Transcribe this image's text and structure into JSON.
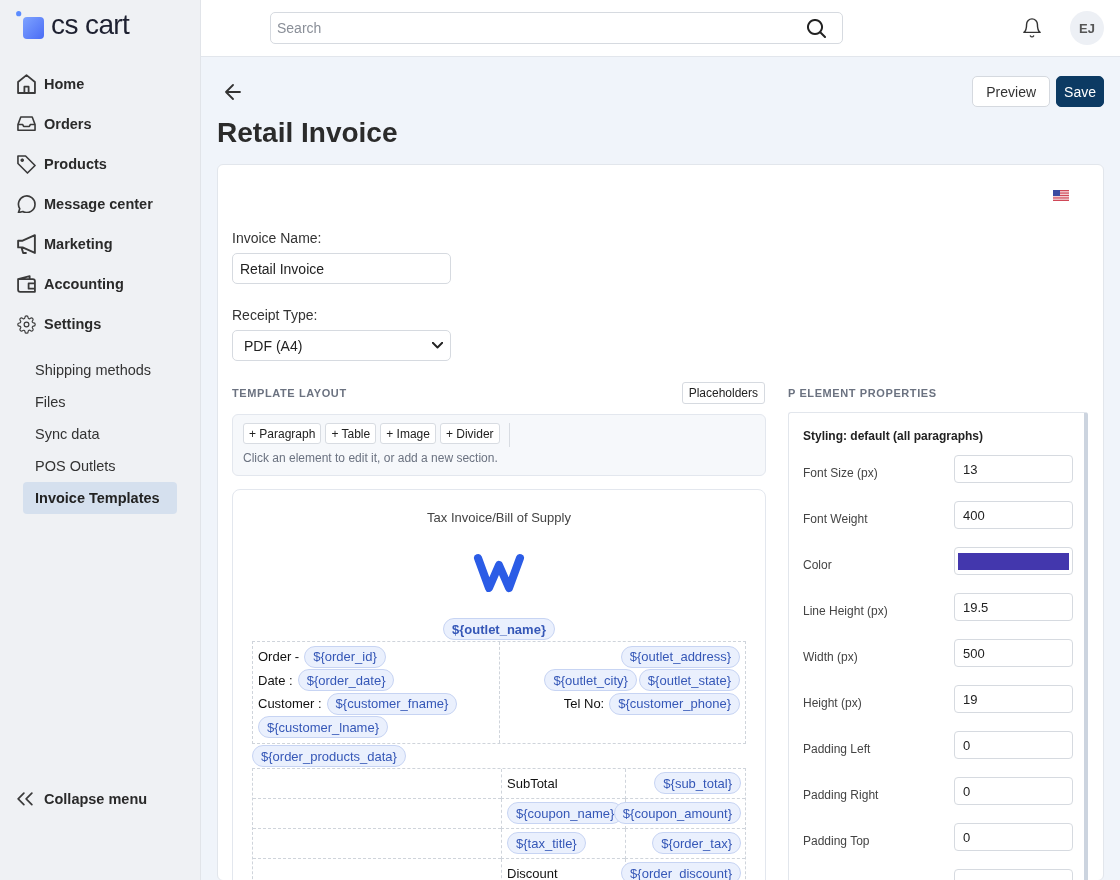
{
  "sidebar": {
    "logo_text": "cs cart",
    "items": [
      {
        "label": "Home",
        "selected": false
      },
      {
        "label": "Orders",
        "selected": false
      },
      {
        "label": "Products",
        "selected": false
      },
      {
        "label": "Message center",
        "selected": false
      },
      {
        "label": "Marketing",
        "selected": false
      },
      {
        "label": "Accounting",
        "selected": false
      },
      {
        "label": "Settings",
        "selected": false,
        "children": [
          {
            "label": "Shipping methods",
            "selected": false
          },
          {
            "label": "Files",
            "selected": false
          },
          {
            "label": "Sync data",
            "selected": false
          },
          {
            "label": "POS Outlets",
            "selected": false
          },
          {
            "label": "Invoice Templates",
            "selected": true
          }
        ]
      }
    ],
    "collapse_label": "Collapse menu"
  },
  "topbar": {
    "search": {
      "placeholder": "Search"
    },
    "avatar_initials": "EJ"
  },
  "header": {
    "title": "Retail Invoice",
    "buttons": [
      {
        "label": "Preview",
        "kind": "secondary"
      },
      {
        "label": "Save",
        "kind": "primary"
      }
    ]
  },
  "form": {
    "fields": [
      {
        "label": "Invoice Name:",
        "kind": "text",
        "value": "Retail Invoice"
      },
      {
        "label": "Receipt Type:",
        "kind": "select",
        "value": "PDF (A4)"
      }
    ]
  },
  "template_layout": {
    "heading": "TEMPLATE LAYOUT",
    "placeholders_button": "Placeholders",
    "tools": [
      "+ Paragraph",
      "+ Table",
      "+ Image",
      "+ Divider"
    ],
    "hint": "Click an element to edit it, or add a new section.",
    "preview": {
      "title": "Tax Invoice/Bill of Supply",
      "outlet_chip": "${outlet_name}",
      "info": {
        "left": [
          [
            {
              "kind": "text",
              "text": "Order -"
            },
            {
              "kind": "chip",
              "text": "${order_id}"
            }
          ],
          [
            {
              "kind": "text",
              "text": "Date :"
            },
            {
              "kind": "chip",
              "text": "${order_date}"
            }
          ],
          [
            {
              "kind": "text",
              "text": "Customer :"
            },
            {
              "kind": "chip",
              "text": "${customer_fname}"
            }
          ],
          [
            {
              "kind": "chip",
              "text": "${customer_lname}"
            }
          ]
        ],
        "right": [
          [
            {
              "kind": "chip",
              "text": "${outlet_address}"
            }
          ],
          [
            {
              "kind": "chip",
              "text": "${outlet_city}"
            },
            {
              "kind": "chip",
              "text": "${outlet_state}"
            }
          ],
          [
            {
              "kind": "text",
              "text": "Tel No:"
            },
            {
              "kind": "chip",
              "text": "${customer_phone}"
            }
          ]
        ]
      },
      "products_chip": "${order_products_data}",
      "totals": [
        {
          "label": {
            "kind": "text",
            "text": "SubTotal"
          },
          "value": {
            "kind": "chip",
            "text": "${sub_total}"
          }
        },
        {
          "label": {
            "kind": "chip",
            "text": "${coupon_name}"
          },
          "value": {
            "kind": "chip",
            "text": "${coupon_amount}"
          }
        },
        {
          "label": {
            "kind": "chip",
            "text": "${tax_title}"
          },
          "value": {
            "kind": "chip",
            "text": "${order_tax}"
          }
        },
        {
          "label": {
            "kind": "text",
            "text": "Discount"
          },
          "value": {
            "kind": "chip",
            "text": "${order_discount}"
          }
        }
      ]
    }
  },
  "properties": {
    "heading": "P ELEMENT PROPERTIES",
    "styling_title": "Styling: default (all paragraphs)",
    "rows": [
      {
        "kind": "number",
        "label": "Font Size (px)",
        "value": "13"
      },
      {
        "kind": "number",
        "label": "Font Weight",
        "value": "400"
      },
      {
        "kind": "color",
        "label": "Color",
        "color": "#4337ad"
      },
      {
        "kind": "number",
        "label": "Line Height (px)",
        "value": "19.5"
      },
      {
        "kind": "number",
        "label": "Width (px)",
        "value": "500"
      },
      {
        "kind": "number",
        "label": "Height (px)",
        "value": "19"
      },
      {
        "kind": "number",
        "label": "Padding Left",
        "value": "0"
      },
      {
        "kind": "number",
        "label": "Padding Right",
        "value": "0"
      },
      {
        "kind": "number",
        "label": "Padding Top",
        "value": "0"
      },
      {
        "kind": "number"
      }
    ]
  }
}
